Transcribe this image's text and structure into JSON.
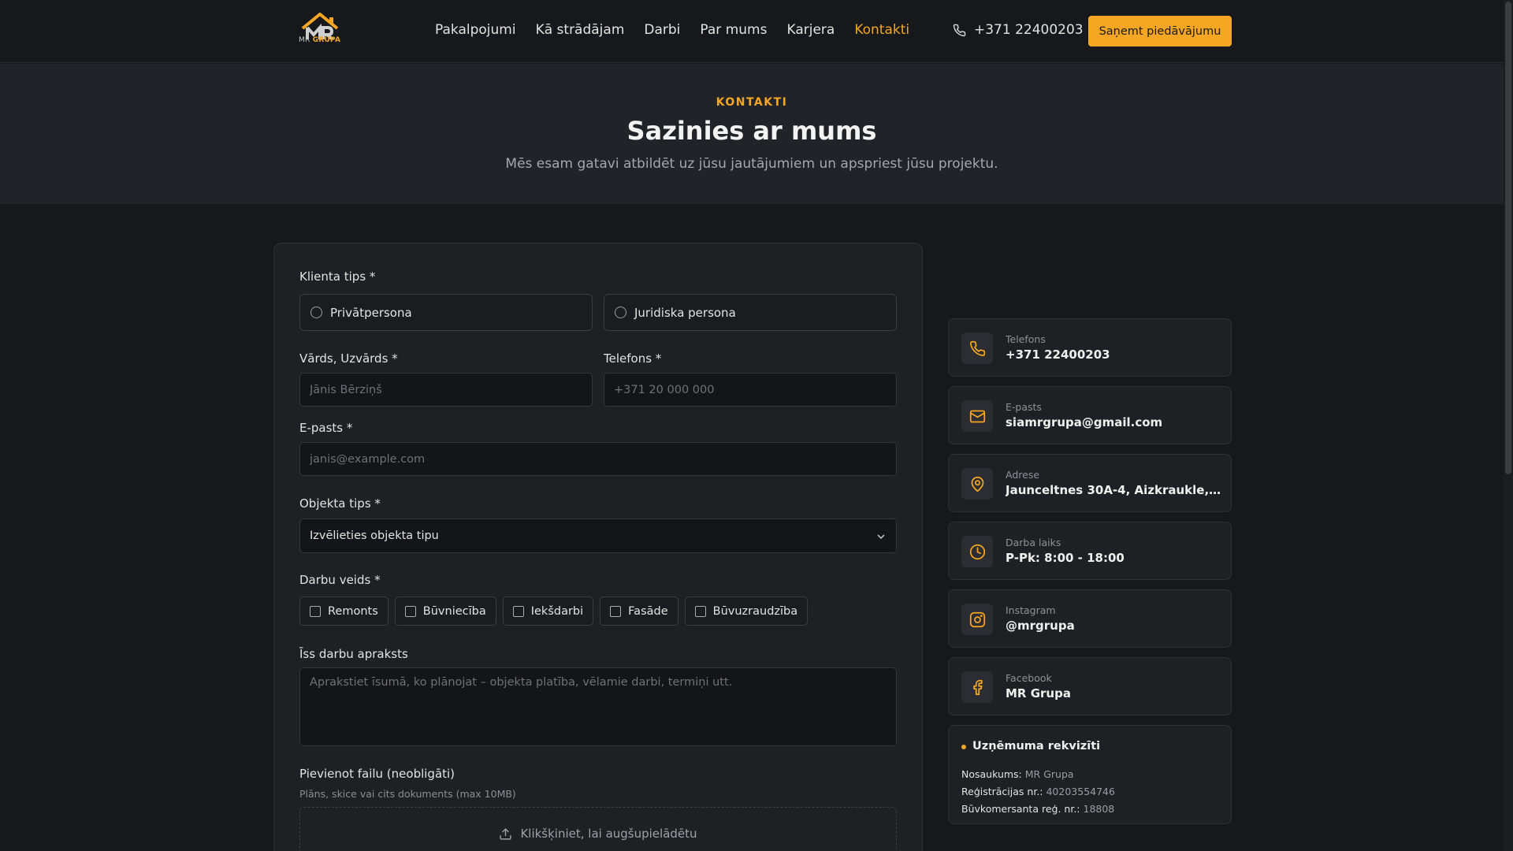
{
  "brand": {
    "logo_mr": "MR",
    "logo_grupa": "GRUPA",
    "accent": "#f5a623"
  },
  "nav": {
    "items": [
      {
        "label": "Pakalpojumi"
      },
      {
        "label": "Kā strādājam"
      },
      {
        "label": "Darbi"
      },
      {
        "label": "Par mums"
      },
      {
        "label": "Karjera"
      },
      {
        "label": "Kontakti"
      }
    ],
    "active": "Kontakti",
    "phone": "+371 22400203",
    "cta_label": "Saņemt piedāvājumu"
  },
  "hero": {
    "eyebrow": "KONTAKTI",
    "title": "Sazinies ar mums",
    "subtitle": "Mēs esam gatavi atbildēt uz jūsu jautājumiem un apspriest jūsu projektu."
  },
  "form": {
    "client_type_label": "Klienta tips *",
    "client_types": [
      "Privātpersona",
      "Juridiska persona"
    ],
    "name_label": "Vārds, Uzvārds *",
    "name_placeholder": "Jānis Bērziņš",
    "phone_label": "Telefons *",
    "phone_placeholder": "+371 20 000 000",
    "email_label": "E-pasts *",
    "email_placeholder": "janis@example.com",
    "object_type_label": "Objekta tips *",
    "object_type_value": "Izvēlieties objekta tipu",
    "work_type_label": "Darbu veids *",
    "work_types": [
      "Remonts",
      "Būvniecība",
      "Iekšdarbi",
      "Fasāde",
      "Būvuzraudzība"
    ],
    "description_label": "Īss darbu apraksts",
    "description_placeholder": "Aprakstiet īsumā, ko plānojat – objekta platība, vēlamie darbi, termiņi utt.",
    "file_label": "Pievienot failu (neobligāti)",
    "file_hint": "Plāns, skice vai cits dokuments (max 10MB)",
    "upload_label": "Klikšķiniet, lai augšupielādētu"
  },
  "contacts": [
    {
      "label": "Telefons",
      "value": "+371 22400203",
      "icon": "phone-icon"
    },
    {
      "label": "E-pasts",
      "value": "siamrgrupa@gmail.com",
      "icon": "mail-icon"
    },
    {
      "label": "Adrese",
      "value": "Jaunceltnes 30A-4, Aizkraukle, ...",
      "icon": "map-pin-icon"
    },
    {
      "label": "Darba laiks",
      "value": "P-Pk: 8:00 - 18:00",
      "icon": "clock-icon"
    },
    {
      "label": "Instagram",
      "value": "@mrgrupa",
      "icon": "instagram-icon"
    },
    {
      "label": "Facebook",
      "value": "MR Grupa",
      "icon": "facebook-icon"
    }
  ],
  "requisites": {
    "title": "Uzņēmuma rekvizīti",
    "lines": [
      {
        "key": "Nosaukums:",
        "value": "MR Grupa"
      },
      {
        "key": "Reģistrācijas nr.:",
        "value": "40203554746"
      },
      {
        "key": "Būvkomersanta reģ. nr.:",
        "value": "18808"
      }
    ]
  }
}
